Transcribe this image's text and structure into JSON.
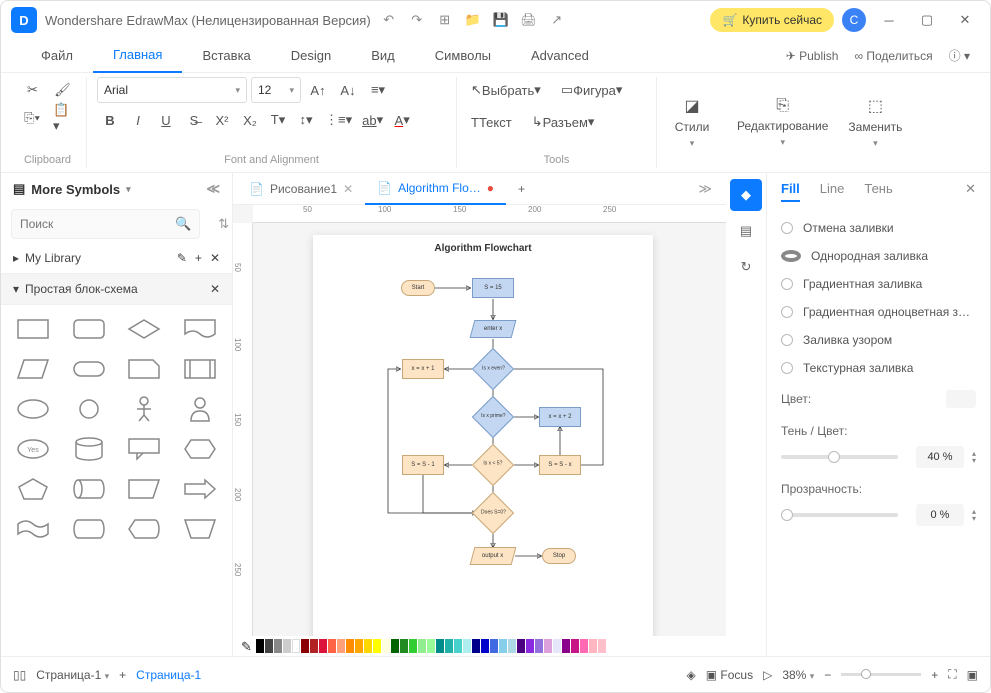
{
  "title": "Wondershare EdrawMax (Нелицензированная Версия)",
  "buy_label": "Купить сейчас",
  "avatar": "C",
  "menu": {
    "file": "Файл",
    "home": "Главная",
    "insert": "Вставка",
    "design": "Design",
    "view": "Вид",
    "symbols": "Символы",
    "advanced": "Advanced",
    "publish": "Publish",
    "share": "Поделиться"
  },
  "ribbon": {
    "font": "Arial",
    "size": "12",
    "clipboard": "Clipboard",
    "fontalign": "Font and Alignment",
    "tools": "Tools",
    "select": "Выбрать",
    "shape": "Фигура",
    "text": "Текст",
    "connector": "Разъем",
    "styles": "Стили",
    "editing": "Редактирование",
    "replace": "Заменить"
  },
  "left": {
    "title": "More Symbols",
    "search_ph": "Поиск",
    "mylib": "My Library",
    "section": "Простая блок-схема"
  },
  "tabs": {
    "t1": "Рисование1",
    "t2": "Algorithm Flo…"
  },
  "chart_title": "Algorithm Flowchart",
  "flow": {
    "start": "Start",
    "s15": "S = 15",
    "enterx": "enter x",
    "even": "Is x even?",
    "xx1": "x = x + 1",
    "prime": "Is x prime?",
    "xx2": "x = x + 2",
    "lt5": "Is x < 5?",
    "ss1": "S = S - 1",
    "ssx": "S = S - x",
    "does": "Does S=0?",
    "outx": "output x",
    "stop": "Stop"
  },
  "right": {
    "fill": "Fill",
    "line": "Line",
    "shadow": "Тень",
    "nofill": "Отмена заливки",
    "solid": "Однородная заливка",
    "gradient": "Градиентная заливка",
    "gradmono": "Градиентная одноцветная з…",
    "pattern": "Заливка узором",
    "texture": "Текстурная заливка",
    "color": "Цвет:",
    "shade": "Тень / Цвет:",
    "transparency": "Прозрачность:",
    "pct40": "40 %",
    "pct0": "0 %"
  },
  "status": {
    "page": "Страница-1",
    "page_active": "Страница-1",
    "focus": "Focus",
    "zoom": "38%"
  }
}
